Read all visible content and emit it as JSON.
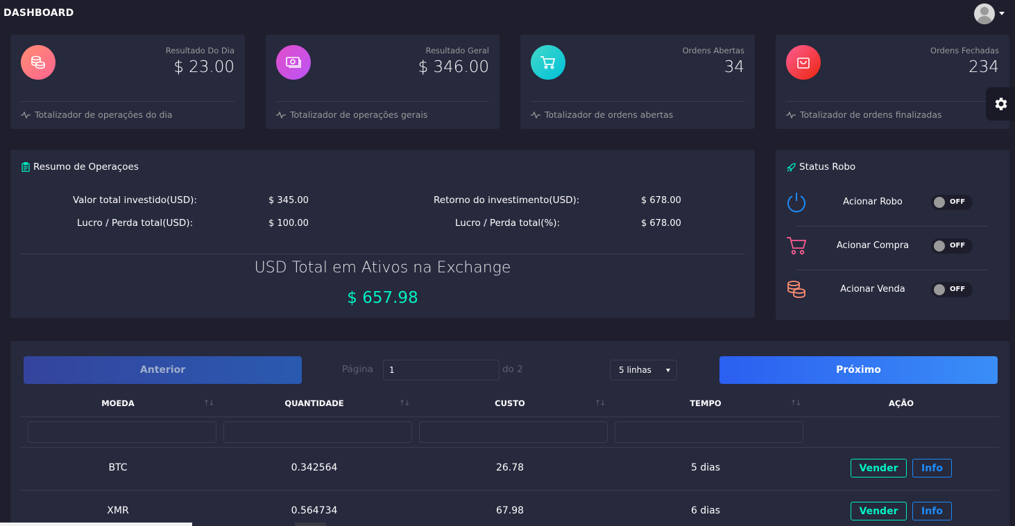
{
  "header": {
    "brand": "DASHBOARD",
    "avatar_icon": "user-avatar-icon"
  },
  "stats": [
    {
      "title": "Resultado Do Dia",
      "value": "$ 23.00",
      "footer": "Totalizador de operações do dia",
      "icon": "coins-icon",
      "color": "#fd5d93"
    },
    {
      "title": "Resultado Geral",
      "value": "$ 346.00",
      "footer": "Totalizador de operações gerais",
      "icon": "money-icon",
      "color": "#ba54f5"
    },
    {
      "title": "Ordens Abertas",
      "value": "34",
      "footer": "Totalizador de ordens abertas",
      "icon": "cart-icon",
      "color": "#00f2c3"
    },
    {
      "title": "Ordens Fechadas",
      "value": "234",
      "footer": "Totalizador de ordens finalizadas",
      "icon": "bag-icon",
      "color": "#ec250d"
    }
  ],
  "resumo": {
    "title": "Resumo de Operaçoes",
    "rows": [
      {
        "label": "Valor total investido(USD):",
        "value": "$ 345.00"
      },
      {
        "label": "Lucro / Perda total(USD):",
        "value": "$ 100.00"
      },
      {
        "label": "Retorno do investimento(USD):",
        "value": "$ 678.00"
      },
      {
        "label": "Lucro / Perda total(%):",
        "value": "$ 678.00"
      }
    ],
    "total_label": "USD Total em Ativos na Exchange",
    "total_value": "$ 657.98"
  },
  "robo": {
    "title": "Status Robo",
    "items": [
      {
        "label": "Acionar Robo",
        "state": "OFF",
        "icon": "power-icon"
      },
      {
        "label": "Acionar Compra",
        "state": "OFF",
        "icon": "cart-icon"
      },
      {
        "label": "Acionar Venda",
        "state": "OFF",
        "icon": "coins-icon"
      }
    ]
  },
  "table": {
    "prev_label": "Anterior",
    "next_label": "Próximo",
    "page_label": "Página",
    "page_value": "1",
    "page_of": "do 2",
    "rows_select": "5 linhas",
    "columns": [
      "MOEDA",
      "QUANTIDADE",
      "CUSTO",
      "TEMPO",
      "AÇÃO"
    ],
    "rows": [
      {
        "moeda": "BTC",
        "quantidade": "0.342564",
        "custo": "26.78",
        "tempo": "5 dias"
      },
      {
        "moeda": "XMR",
        "quantidade": "0.564734",
        "custo": "67.98",
        "tempo": "6 dias"
      }
    ],
    "sell_label": "Vender",
    "info_label": "Info"
  },
  "colors": {
    "background": "#1e1e2d",
    "card": "#27293d",
    "success": "#00f2c3",
    "info": "#1d8cf8"
  }
}
